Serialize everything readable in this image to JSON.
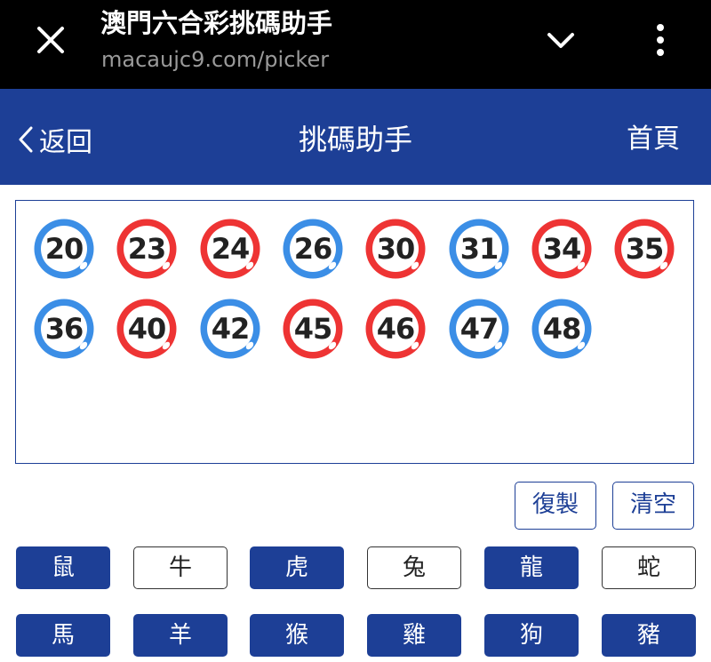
{
  "browser": {
    "title": "澳門六合彩挑碼助手",
    "url": "macaujc9.com/picker"
  },
  "nav": {
    "back_label": "返回",
    "title": "挑碼助手",
    "home_label": "首頁"
  },
  "colors": {
    "navy": "#1d3f96",
    "ball_red": "#ee3434",
    "ball_blue": "#3b8ee6"
  },
  "balls": [
    {
      "number": "20",
      "color": "blue"
    },
    {
      "number": "23",
      "color": "red"
    },
    {
      "number": "24",
      "color": "red"
    },
    {
      "number": "26",
      "color": "blue"
    },
    {
      "number": "30",
      "color": "red"
    },
    {
      "number": "31",
      "color": "blue"
    },
    {
      "number": "34",
      "color": "red"
    },
    {
      "number": "35",
      "color": "red"
    },
    {
      "number": "36",
      "color": "blue"
    },
    {
      "number": "40",
      "color": "red"
    },
    {
      "number": "42",
      "color": "blue"
    },
    {
      "number": "45",
      "color": "red"
    },
    {
      "number": "46",
      "color": "red"
    },
    {
      "number": "47",
      "color": "blue"
    },
    {
      "number": "48",
      "color": "blue"
    }
  ],
  "actions": {
    "copy_label": "復製",
    "clear_label": "清空"
  },
  "zodiacs": [
    {
      "label": "鼠",
      "selected": true
    },
    {
      "label": "牛",
      "selected": false
    },
    {
      "label": "虎",
      "selected": true
    },
    {
      "label": "兔",
      "selected": false
    },
    {
      "label": "龍",
      "selected": true
    },
    {
      "label": "蛇",
      "selected": false
    },
    {
      "label": "馬",
      "selected": true
    },
    {
      "label": "羊",
      "selected": true
    },
    {
      "label": "猴",
      "selected": true
    },
    {
      "label": "雞",
      "selected": true
    },
    {
      "label": "狗",
      "selected": true
    },
    {
      "label": "豬",
      "selected": true
    }
  ]
}
